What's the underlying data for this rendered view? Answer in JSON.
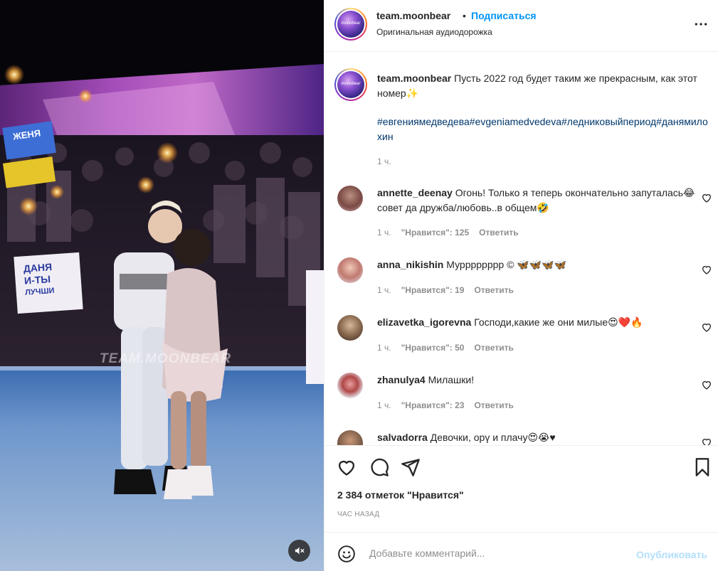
{
  "media": {
    "watermark": "TEAM.MOONBEAR",
    "banner_left": "ЖЕНЯ",
    "banner_bottom_l1": "ДАНЯ",
    "banner_bottom_l2": "И-ТЫ",
    "banner_bottom_l3": "ЛУЧШИ",
    "mute_icon": "speaker-muted-icon"
  },
  "header": {
    "username": "team.moonbear",
    "dot": "•",
    "follow_label": "Подписаться",
    "audio": "Оригинальная аудиодорожка",
    "avatar_text": "moonbear",
    "more_icon": "more-options-icon"
  },
  "caption": {
    "username": "team.moonbear",
    "text": "Пусть 2022 год будет таким же прекрасным, как этот номер",
    "emoji": "✨",
    "hashtags": "#евгениямедведева#evgeniamedvedeva#ледниковыйпериод#данямилохин",
    "time": "1 ч."
  },
  "comments": [
    {
      "username": "annette_deenay",
      "text": "Огонь! Только я теперь окончательно запуталась😂 совет да дружба/любовь..в общем🤣",
      "time": "1 ч.",
      "likes": "\"Нравится\": 125",
      "reply": "Ответить"
    },
    {
      "username": "anna_nikishin",
      "text": "Мурррррррр © 🦋🦋🦋🦋",
      "time": "1 ч.",
      "likes": "\"Нравится\": 19",
      "reply": "Ответить"
    },
    {
      "username": "elizavetka_igorevna",
      "text": "Господи,какие же они милые😍❤️🔥",
      "time": "1 ч.",
      "likes": "\"Нравится\": 50",
      "reply": "Ответить"
    },
    {
      "username": "zhanulya4",
      "text": "Милашки!",
      "time": "1 ч.",
      "likes": "\"Нравится\": 23",
      "reply": "Ответить"
    },
    {
      "username": "salvadorra",
      "text": "Девочки, орү и плачу😍😭♥",
      "time": "",
      "likes": "",
      "reply": ""
    }
  ],
  "actions": {
    "like_icon": "heart-icon",
    "comment_icon": "comment-icon",
    "share_icon": "send-icon",
    "save_icon": "bookmark-icon",
    "likes_text": "2 384 отметок \"Нравится\"",
    "time_text": "час назад"
  },
  "add_comment": {
    "emoji_icon": "emoji-icon",
    "placeholder": "Добавьте комментарий...",
    "publish_label": "Опубликовать"
  },
  "colors": {
    "link": "#0095f6",
    "hashtag": "#00376b",
    "muted": "#8e8e8e",
    "publish_disabled": "#b2dffc"
  }
}
